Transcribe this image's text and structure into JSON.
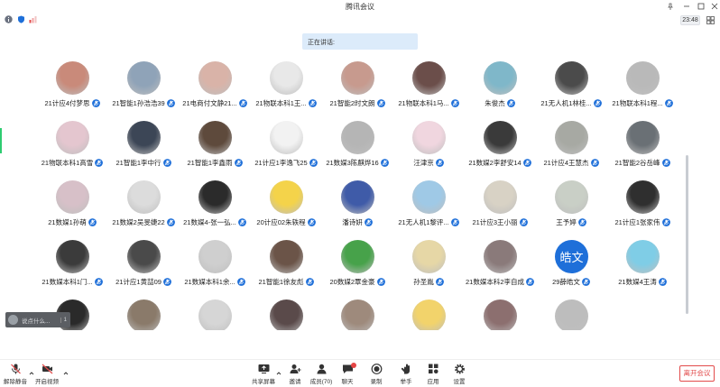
{
  "window": {
    "title": "腾讯会议",
    "time": "23:48"
  },
  "banner": {
    "speaking_label": "正在讲话:"
  },
  "toast": {
    "text": "说点什么...",
    "count": "1"
  },
  "participants": [
    {
      "name": "21计应4付梦思",
      "avatar": "photo",
      "color": "#c98a7a"
    },
    {
      "name": "21智能1孙浩浩39",
      "avatar": "photo",
      "color": "#8fa3b8"
    },
    {
      "name": "21电商付文静21...",
      "avatar": "photo",
      "color": "#d9b3a8"
    },
    {
      "name": "21物联本科1王...",
      "avatar": "photo",
      "color": "#e8e8e8"
    },
    {
      "name": "21智能2时文朗",
      "avatar": "photo",
      "color": "#c79a8e"
    },
    {
      "name": "21物联本科1马...",
      "avatar": "photo",
      "color": "#6b4e4a"
    },
    {
      "name": "朱俊杰",
      "avatar": "photo",
      "color": "#7fb7c9"
    },
    {
      "name": "21无人机1林桂...",
      "avatar": "photo",
      "color": "#4b4b4b"
    },
    {
      "name": "21物联本科1程...",
      "avatar": "photo",
      "color": "#b9b9b9"
    },
    {
      "name": "21物联本科1高雪",
      "avatar": "photo",
      "color": "#e4c6cf"
    },
    {
      "name": "21智能1李中行",
      "avatar": "photo",
      "color": "#3c4656"
    },
    {
      "name": "21智能1李鑫雨",
      "avatar": "photo",
      "color": "#5e4a3c"
    },
    {
      "name": "21计应1李逸飞25",
      "avatar": "photo",
      "color": "#f2f2f2"
    },
    {
      "name": "21数媒3陈麒烨16",
      "avatar": "photo",
      "color": "#b5b5b5"
    },
    {
      "name": "汪津京",
      "avatar": "photo",
      "color": "#f0d6df"
    },
    {
      "name": "21数媒2李舒安14",
      "avatar": "photo",
      "color": "#3a3a3a"
    },
    {
      "name": "21计应4王慧杰",
      "avatar": "photo",
      "color": "#a7a9a3"
    },
    {
      "name": "21智能2谷岳峰",
      "avatar": "photo",
      "color": "#6a7075"
    },
    {
      "name": "21数媒1孙萌",
      "avatar": "photo",
      "color": "#d7c0c8"
    },
    {
      "name": "21数媒2吴旻婕22",
      "avatar": "photo",
      "color": "#dcdcdc"
    },
    {
      "name": "21数媒4-张一弘...",
      "avatar": "photo",
      "color": "#2b2b2b"
    },
    {
      "name": "20计应02朱轶程",
      "avatar": "photo",
      "color": "#f4d34a"
    },
    {
      "name": "潘诗妍",
      "avatar": "photo",
      "color": "#3f5ba8"
    },
    {
      "name": "21无人机1黎评...",
      "avatar": "photo",
      "color": "#9fc9e6"
    },
    {
      "name": "21计应3王小丽",
      "avatar": "photo",
      "color": "#d8d2c5"
    },
    {
      "name": "王予婷",
      "avatar": "photo",
      "color": "#c9cfc6"
    },
    {
      "name": "21计应1张家伟",
      "avatar": "photo",
      "color": "#2f2f2f"
    },
    {
      "name": "21数媒本科1门...",
      "avatar": "photo",
      "color": "#3b3b3b"
    },
    {
      "name": "21计应1黄喆09",
      "avatar": "photo",
      "color": "#4a4a4a"
    },
    {
      "name": "21数媒本科1余...",
      "avatar": "photo",
      "color": "#cfcfcf"
    },
    {
      "name": "21智能1徐友彪",
      "avatar": "photo",
      "color": "#6b5448"
    },
    {
      "name": "20数媒2覃金豪",
      "avatar": "photo",
      "color": "#47a24a"
    },
    {
      "name": "孙圣胤",
      "avatar": "photo",
      "color": "#e6d7a6"
    },
    {
      "name": "21数媒本科2李自成",
      "avatar": "photo",
      "color": "#8a7a7a"
    },
    {
      "name": "29薛皓文",
      "avatar": "text",
      "text": "皓文",
      "color": "#1e6fd9"
    },
    {
      "name": "21数媒4王涛",
      "avatar": "photo",
      "color": "#7fcde6"
    },
    {
      "name": "",
      "avatar": "photo",
      "color": "#2a2a2a"
    },
    {
      "name": "",
      "avatar": "photo",
      "color": "#8a7a6a"
    },
    {
      "name": "",
      "avatar": "photo",
      "color": "#d6d6d6"
    },
    {
      "name": "",
      "avatar": "photo",
      "color": "#5a4a4a"
    },
    {
      "name": "",
      "avatar": "photo",
      "color": "#9e8a7c"
    },
    {
      "name": "",
      "avatar": "photo",
      "color": "#f2d36b"
    },
    {
      "name": "",
      "avatar": "photo",
      "color": "#8c6f6f"
    },
    {
      "name": "",
      "avatar": "photo",
      "color": "#bdbdbd"
    }
  ],
  "toolbar": {
    "unmute": "解除静音",
    "start_video": "开启视频",
    "share_screen": "共享屏幕",
    "invite": "邀请",
    "members": "成员(70)",
    "chat": "聊天",
    "record": "录制",
    "raise_hand": "举手",
    "apps": "应用",
    "settings": "设置",
    "leave": "离开会议"
  },
  "colors": {
    "accent": "#1e6fd9",
    "danger": "#e24b4b",
    "banner": "#dcebfa"
  }
}
